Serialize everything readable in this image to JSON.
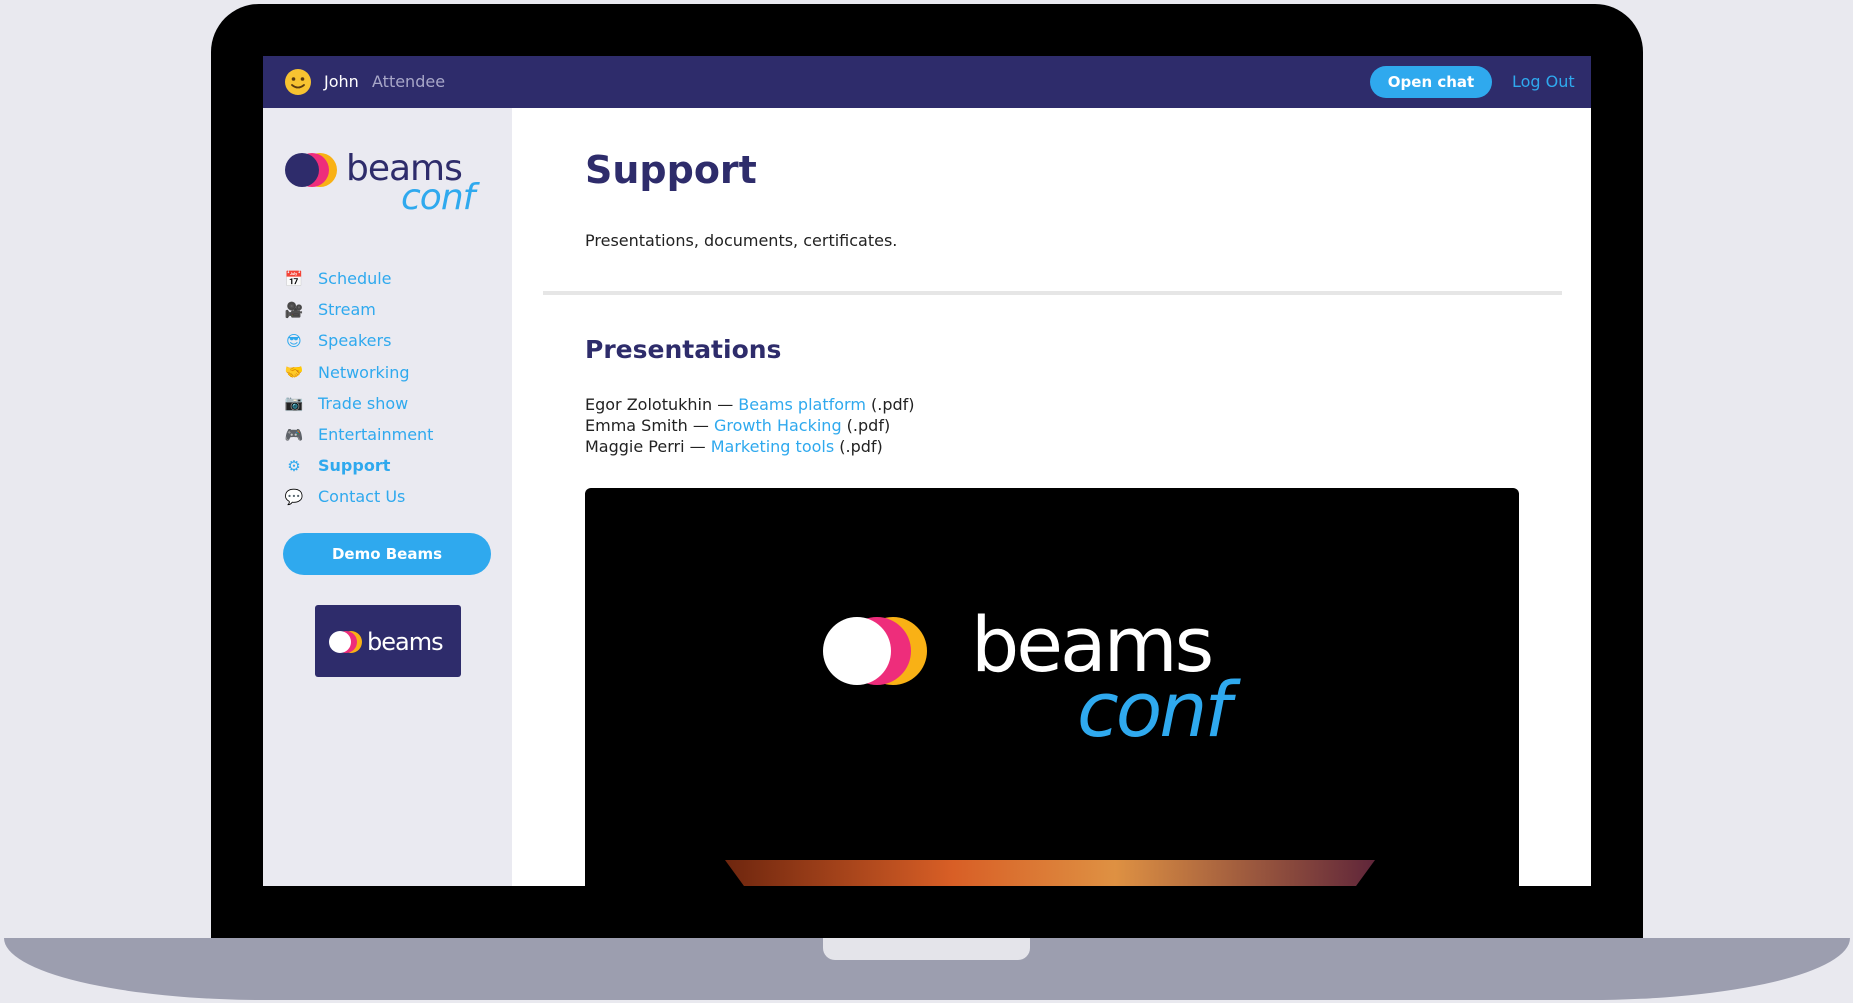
{
  "topbar": {
    "user_name": "John",
    "user_role": "Attendee",
    "open_chat_label": "Open chat",
    "logout_label": "Log Out"
  },
  "brand": {
    "logo_primary": "beams",
    "logo_secondary": "conf",
    "badge_text": "beams",
    "colors": {
      "navy": "#2e2c6b",
      "blue": "#2fa9ee",
      "pink": "#ee2d7b",
      "orange": "#f9b115"
    }
  },
  "sidebar": {
    "items": [
      {
        "label": "Schedule",
        "icon": "calendar-icon",
        "glyph": "📅"
      },
      {
        "label": "Stream",
        "icon": "video-camera-icon",
        "glyph": "🎥"
      },
      {
        "label": "Speakers",
        "icon": "sunglasses-face-icon",
        "glyph": "😎"
      },
      {
        "label": "Networking",
        "icon": "handshake-icon",
        "glyph": "🤝"
      },
      {
        "label": "Trade show",
        "icon": "camera-icon",
        "glyph": "📷"
      },
      {
        "label": "Entertainment",
        "icon": "gamepad-icon",
        "glyph": "🎮"
      },
      {
        "label": "Support",
        "icon": "gear-icon",
        "glyph": "⚙",
        "active": true
      },
      {
        "label": "Contact Us",
        "icon": "speech-bubble-icon",
        "glyph": "💬"
      }
    ],
    "demo_button_label": "Demo Beams"
  },
  "main": {
    "title": "Support",
    "description": "Presentations, documents, certificates.",
    "presentations_title": "Presentations",
    "presentations": [
      {
        "author": "Egor Zolotukhin",
        "sep": " — ",
        "link": "Beams platform",
        "suffix": " (.pdf)"
      },
      {
        "author": "Emma Smith",
        "sep": " — ",
        "link": "Growth Hacking",
        "suffix": " (.pdf)"
      },
      {
        "author": "Maggie Perri",
        "sep": " — ",
        "link": "Marketing tools",
        "suffix": " (.pdf)"
      }
    ],
    "video_logo_primary": "beams",
    "video_logo_secondary": "conf"
  }
}
